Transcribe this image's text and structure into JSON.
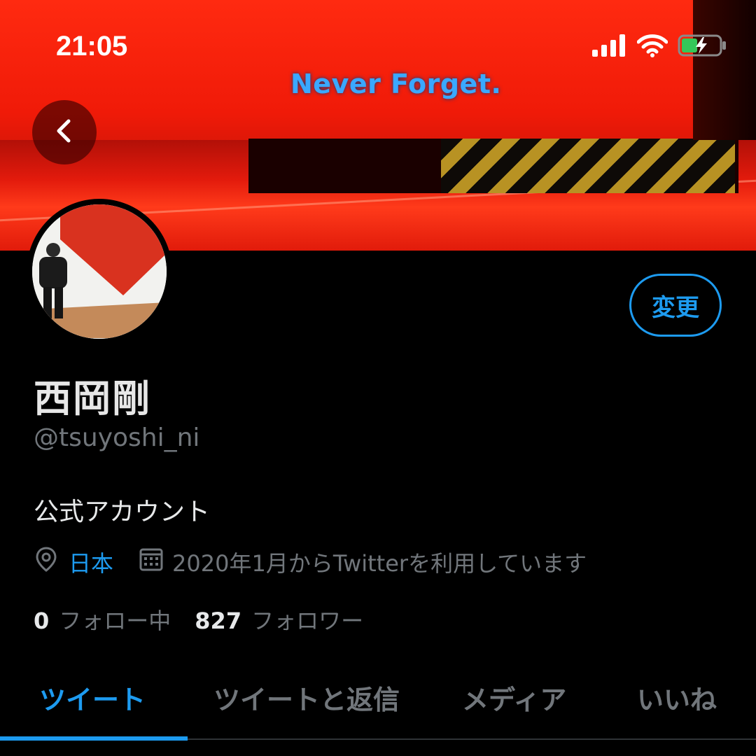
{
  "status_bar": {
    "time": "21:05",
    "icons": [
      "signal-icon",
      "wifi-icon",
      "battery-charging-icon"
    ]
  },
  "banner": {
    "text": "Never Forget.",
    "colors": {
      "primary": "#f01a08",
      "text": "#3aa8ff"
    }
  },
  "navigation": {
    "back_icon": "chevron-left-icon"
  },
  "profile": {
    "display_name": "西岡剛",
    "handle": "@tsuyoshi_ni",
    "bio": "公式アカウント",
    "location": "日本",
    "joined": "2020年1月からTwitterを利用しています",
    "edit_button_label": "変更",
    "following_count": "0",
    "following_label": "フォロー中",
    "followers_count": "827",
    "followers_label": "フォロワー"
  },
  "tabs": [
    {
      "label": "ツイート",
      "active": true
    },
    {
      "label": "ツイートと返信",
      "active": false
    },
    {
      "label": "メディア",
      "active": false
    },
    {
      "label": "いいね",
      "active": false
    }
  ],
  "colors": {
    "accent": "#1d9bf0",
    "background": "#000000",
    "muted_text": "#71767b"
  }
}
